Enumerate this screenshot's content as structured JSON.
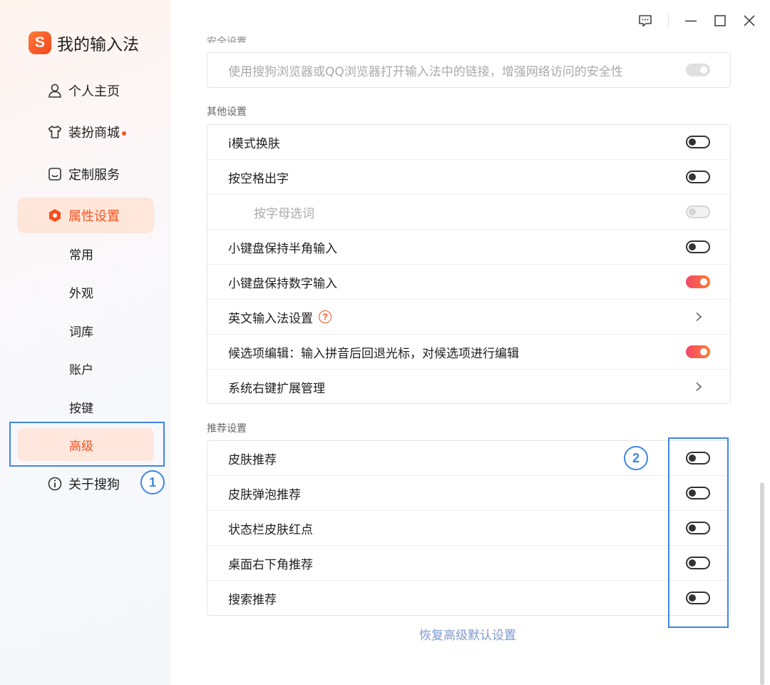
{
  "app": {
    "logo_letter": "S",
    "title": "我的输入法",
    "brand_color": "#f4511e"
  },
  "nav": {
    "items": [
      {
        "label": "个人主页",
        "icon": "user-icon"
      },
      {
        "label": "装扮商城",
        "icon": "tshirt-icon",
        "badge": "red-dot"
      },
      {
        "label": "定制服务",
        "icon": "inbox-icon"
      },
      {
        "label": "属性设置",
        "icon": "hexagon-gear-icon",
        "active": true
      }
    ],
    "sub_items": [
      "常用",
      "外观",
      "词库",
      "账户",
      "按键",
      "高级"
    ],
    "active_sub": "高级",
    "about": {
      "label": "关于搜狗",
      "icon": "info-icon"
    }
  },
  "window_controls": [
    "feedback-icon",
    "minimize-icon",
    "maximize-icon",
    "close-icon"
  ],
  "security_section": {
    "label_partial": "安全设置",
    "row": {
      "label": "使用搜狗浏览器或QQ浏览器打开输入法中的链接，增强网络访问的安全性",
      "state": "on-disabled"
    }
  },
  "other_settings": {
    "label": "其他设置",
    "rows": [
      {
        "label": "i模式换肤",
        "control": "toggle",
        "state": "off"
      },
      {
        "label": "按空格出字",
        "control": "toggle",
        "state": "off"
      },
      {
        "label": "按字母选词",
        "control": "toggle",
        "state": "disabled"
      },
      {
        "label": "小键盘保持半角输入",
        "control": "toggle",
        "state": "off"
      },
      {
        "label": "小键盘保持数字输入",
        "control": "toggle",
        "state": "on"
      },
      {
        "label": "英文输入法设置",
        "control": "chevron",
        "help_icon": "?"
      },
      {
        "label": "候选项编辑：输入拼音后回退光标，对候选项进行编辑",
        "control": "toggle",
        "state": "on"
      },
      {
        "label": "系统右键扩展管理",
        "control": "chevron"
      }
    ]
  },
  "recommend_settings": {
    "label": "推荐设置",
    "rows": [
      {
        "label": "皮肤推荐",
        "state": "off"
      },
      {
        "label": "皮肤弹泡推荐",
        "state": "off"
      },
      {
        "label": "状态栏皮肤红点",
        "state": "off"
      },
      {
        "label": "桌面右下角推荐",
        "state": "off"
      },
      {
        "label": "搜索推荐",
        "state": "off"
      }
    ]
  },
  "restore_link": "恢复高级默认设置",
  "annotations": {
    "marker_1": "1",
    "marker_2": "2",
    "color": "#3f86e3"
  },
  "colors": {
    "toggle_on": "#f2476b",
    "toggle_off": "#333333",
    "link": "#7d9bd1"
  }
}
